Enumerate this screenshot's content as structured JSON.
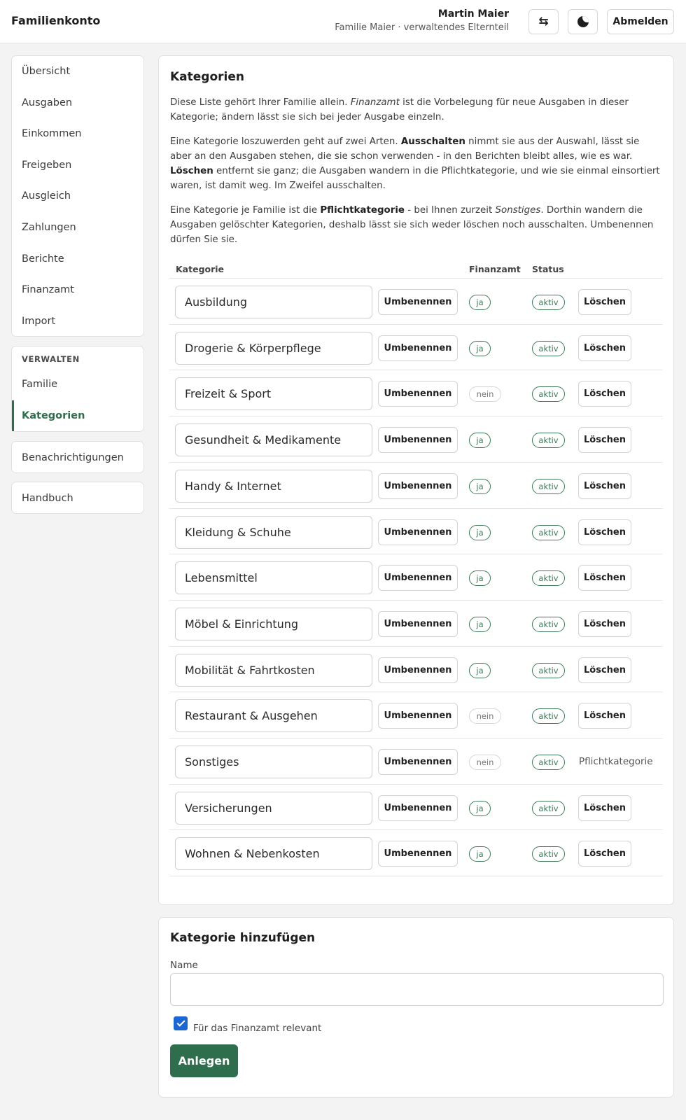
{
  "header": {
    "brand": "Familienkonto",
    "user_name": "Martin Maier",
    "user_sub": "Familie Maier · verwaltendes Elternteil",
    "swap_glyph": "⇆",
    "logout_label": "Abmelden"
  },
  "sidebar": {
    "nav": [
      "Übersicht",
      "Ausgaben",
      "Einkommen",
      "Freigeben",
      "Ausgleich",
      "Zahlungen",
      "Berichte",
      "Finanzamt",
      "Import"
    ],
    "admin_heading": "VERWALTEN",
    "admin": [
      "Familie",
      "Kategorien"
    ],
    "active": "Kategorien",
    "notifications": "Benachrichtigungen",
    "manual": "Handbuch"
  },
  "categories_card": {
    "title": "Kategorien",
    "para1": "Diese Liste gehört Ihrer Familie allein. <i>Finanzamt</i> ist die Vorbelegung für neue Ausgaben in dieser Kategorie; ändern lässt sie sich bei jeder Ausgabe einzeln.",
    "para2": "Eine Kategorie loszuwerden geht auf zwei Arten. <b>Ausschalten</b> nimmt sie aus der Auswahl, lässt sie aber an den Ausgaben stehen, die sie schon verwenden - in den Berichten bleibt alles, wie es war. <b>Löschen</b> entfernt sie ganz; die Ausgaben wandern in die Pflichtkategorie, und wie sie einmal einsortiert waren, ist damit weg. Im Zweifel ausschalten.",
    "para3": "Eine Kategorie je Familie ist die <b>Pflichtkategorie</b> - bei Ihnen zurzeit <i>Sonstiges</i>. Dorthin wandern die Ausgaben gelöschter Kategorien, deshalb lässt sie sich weder löschen noch ausschalten. Umbenennen dürfen Sie sie.",
    "columns": {
      "category": "Kategorie",
      "tax": "Finanzamt",
      "status": "Status"
    },
    "rename_label": "Umbenennen",
    "delete_label": "Löschen",
    "mandatory_label": "Pflichtkategorie",
    "rows": [
      {
        "name": "Ausbildung",
        "tax": "ja",
        "status": "aktiv",
        "mandatory": false
      },
      {
        "name": "Drogerie & Körperpflege",
        "tax": "ja",
        "status": "aktiv",
        "mandatory": false
      },
      {
        "name": "Freizeit & Sport",
        "tax": "nein",
        "status": "aktiv",
        "mandatory": false
      },
      {
        "name": "Gesundheit & Medikamente",
        "tax": "ja",
        "status": "aktiv",
        "mandatory": false
      },
      {
        "name": "Handy & Internet",
        "tax": "ja",
        "status": "aktiv",
        "mandatory": false
      },
      {
        "name": "Kleidung & Schuhe",
        "tax": "ja",
        "status": "aktiv",
        "mandatory": false
      },
      {
        "name": "Lebensmittel",
        "tax": "ja",
        "status": "aktiv",
        "mandatory": false
      },
      {
        "name": "Möbel & Einrichtung",
        "tax": "ja",
        "status": "aktiv",
        "mandatory": false
      },
      {
        "name": "Mobilität & Fahrtkosten",
        "tax": "ja",
        "status": "aktiv",
        "mandatory": false
      },
      {
        "name": "Restaurant & Ausgehen",
        "tax": "nein",
        "status": "aktiv",
        "mandatory": false
      },
      {
        "name": "Sonstiges",
        "tax": "nein",
        "status": "aktiv",
        "mandatory": true
      },
      {
        "name": "Versicherungen",
        "tax": "ja",
        "status": "aktiv",
        "mandatory": false
      },
      {
        "name": "Wohnen & Nebenkosten",
        "tax": "ja",
        "status": "aktiv",
        "mandatory": false
      }
    ]
  },
  "add_card": {
    "title": "Kategorie hinzufügen",
    "name_label": "Name",
    "name_value": "",
    "tax_checkbox_label": "Für das Finanzamt relevant",
    "tax_checked": true,
    "submit_label": "Anlegen"
  },
  "colors": {
    "accent": "#2f6e4c",
    "checkbox": "#1a66d6"
  }
}
